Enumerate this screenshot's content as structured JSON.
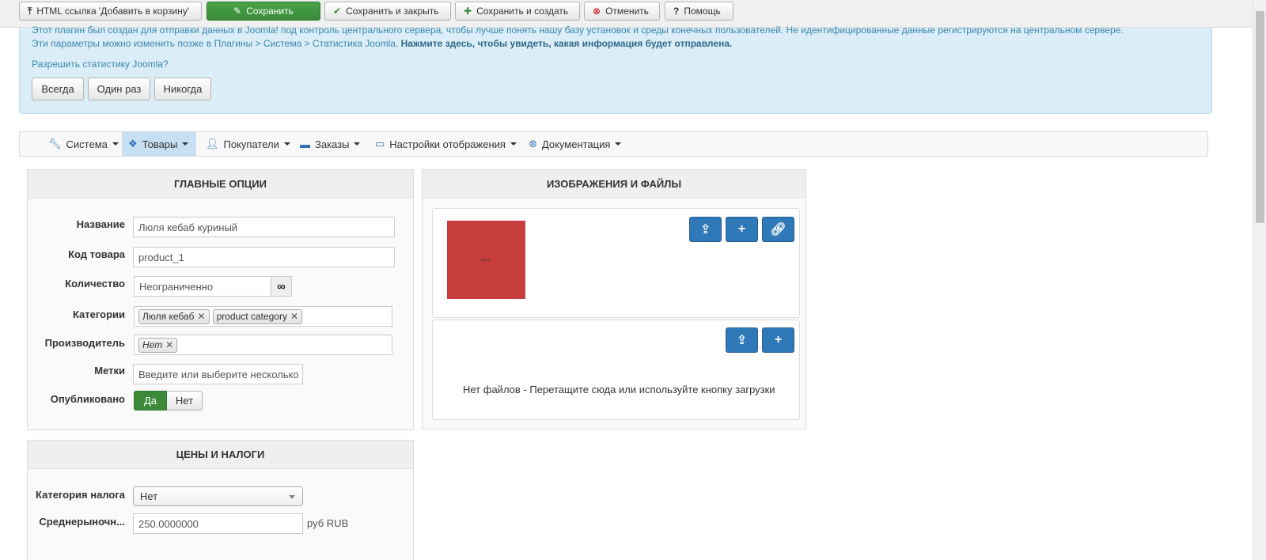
{
  "toolbar": {
    "html_link_label": "HTML ссылка 'Добавить в корзину'",
    "save_label": "Сохранить",
    "save_close_label": "Сохранить и закрыть",
    "save_new_label": "Сохранить и создать",
    "cancel_label": "Отменить",
    "help_label": "Помощь"
  },
  "alert": {
    "line1": "Этот плагин был создан для отправки данных в Joomla! под контроль центрального сервера, чтобы лучше понять нашу базу установок и среды конечных пользователей. Не идентифицированные данные регистрируются на центральном сервере.",
    "line2": "Эти параметры можно изменить позже в Плагины > Система > Статистика Joomla.",
    "line2_bold": "Нажмите здесь, чтобы увидеть, какая информация будет отправлена.",
    "question": "Разрешить статистику Joomla?",
    "btn_always": "Всегда",
    "btn_once": "Один раз",
    "btn_never": "Никогда"
  },
  "nav": {
    "system": "Система",
    "products": "Товары",
    "customers": "Покупатели",
    "orders": "Заказы",
    "display": "Настройки отображения",
    "docs": "Документация"
  },
  "main_options": {
    "heading": "ГЛАВНЫЕ ОПЦИИ",
    "name_label": "Название",
    "name_value": "Люля кебаб куриный",
    "code_label": "Код товара",
    "code_value": "product_1",
    "qty_label": "Количество",
    "qty_value": "Неограниченно",
    "qty_addon": "∞",
    "categories_label": "Категории",
    "categories": [
      "Люля кебаб",
      "product category"
    ],
    "manufacturer_label": "Производитель",
    "manufacturer_tag": "Нет",
    "tags_label": "Метки",
    "tags_placeholder": "Введите или выберите несколько в",
    "published_label": "Опубликовано",
    "published_yes": "Да",
    "published_no": "Нет"
  },
  "prices": {
    "heading": "ЦЕНЫ И НАЛОГИ",
    "tax_label": "Категория налога",
    "tax_value": "Нет",
    "avg_label": "Среднерыночн...",
    "avg_value": "250.0000000",
    "currency": "руб RUB"
  },
  "images": {
    "heading": "ИЗОБРАЖЕНИЯ И ФАЙЛЫ",
    "image_caption": "IMAGE",
    "no_files": "Нет файлов - Перетащите сюда или используйте кнопку загрузки"
  },
  "colors": {
    "accent_blue": "#2f79b8",
    "save_green": "#3a8a3a",
    "alert_bg": "#dbedf7",
    "thumb_red": "#c83e3e"
  }
}
